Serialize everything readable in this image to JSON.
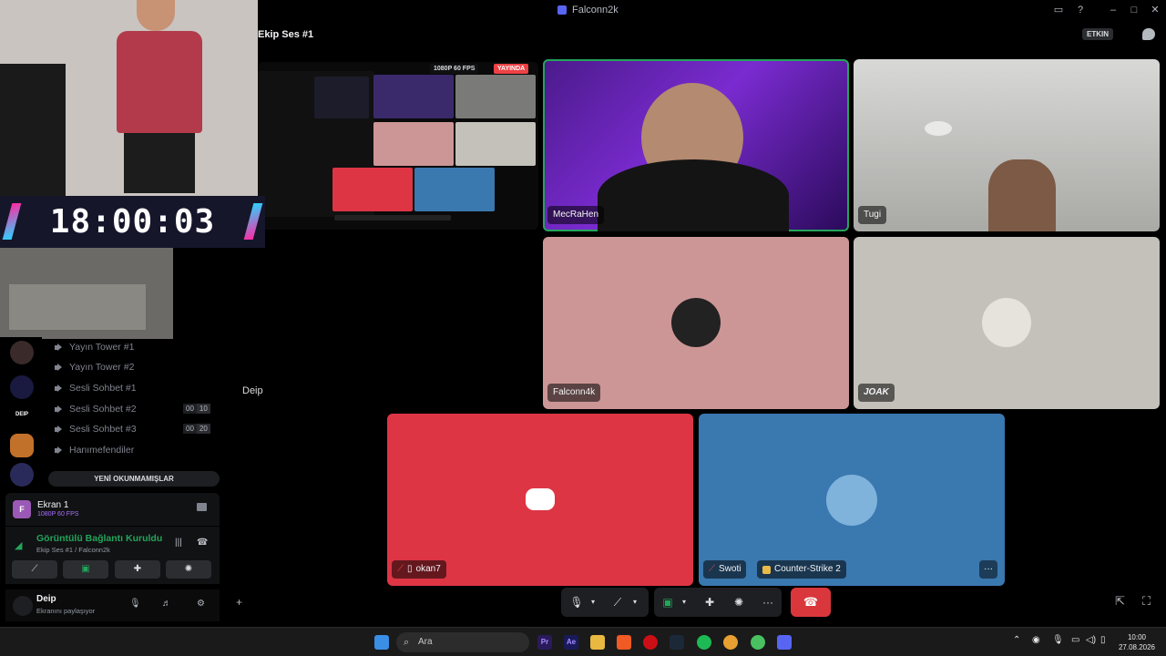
{
  "window": {
    "title": "Falconn2k"
  },
  "channel": {
    "title": "Ekip Ses #1",
    "activity_badge": "ETKIN"
  },
  "overlay": {
    "clock": "18:00:03"
  },
  "sidebar": {
    "channels": [
      {
        "name": "Yayın Tower #1"
      },
      {
        "name": "Yayın Tower #2"
      },
      {
        "name": "Sesli Sohbet #1"
      },
      {
        "name": "Sesli Sohbet #2",
        "count": "00",
        "limit": "10"
      },
      {
        "name": "Sesli Sohbet #3",
        "count": "00",
        "limit": "20"
      },
      {
        "name": "Hanımefendiler"
      }
    ],
    "new_unreads_button": "YENİ OKUNMAMIŞLAR",
    "server_label": "DEIP"
  },
  "screen_share_panel": {
    "avatar_letter": "F",
    "title": "Ekran 1",
    "quality": "1080P 60 FPS"
  },
  "voice_panel": {
    "status": "Görüntülü Bağlantı Kuruldu",
    "location": "Ekip Ses #1 / Falconn2k"
  },
  "user_panel": {
    "name": "Deip",
    "status": "Ekranını paylaşıyor"
  },
  "stage": {
    "share": {
      "name": "Deip",
      "resolution_badge": "1080P 60 FPS",
      "live_badge": "YAYINDA"
    },
    "tiles": [
      {
        "name": "MecRaHen"
      },
      {
        "name": "Tugi"
      },
      {
        "name": "Falconn4k"
      },
      {
        "name": "JOAK"
      },
      {
        "name": "okan7"
      },
      {
        "name": "Swoti",
        "activity": "Counter-Strike 2"
      }
    ],
    "share_owner_label": "Deip"
  },
  "taskbar": {
    "search_placeholder": "Ara",
    "time": "10:00",
    "date": "27.08.2026"
  },
  "colors": {
    "green": "#23a55a",
    "red": "#da373c",
    "pink_tile": "#cd9696",
    "grey_tile": "#c4c1ba",
    "discord_red_tile": "#dd3544",
    "blue_tile": "#3a78b0"
  },
  "icons": [
    "search-icon",
    "mic-icon",
    "camera-off-icon",
    "screen-share-icon",
    "activities-icon",
    "soundboard-icon",
    "more-icon",
    "hang-up-icon",
    "chat-icon",
    "popout-icon",
    "fullscreen-icon",
    "add-friend-icon",
    "settings-icon",
    "headphones-icon"
  ]
}
